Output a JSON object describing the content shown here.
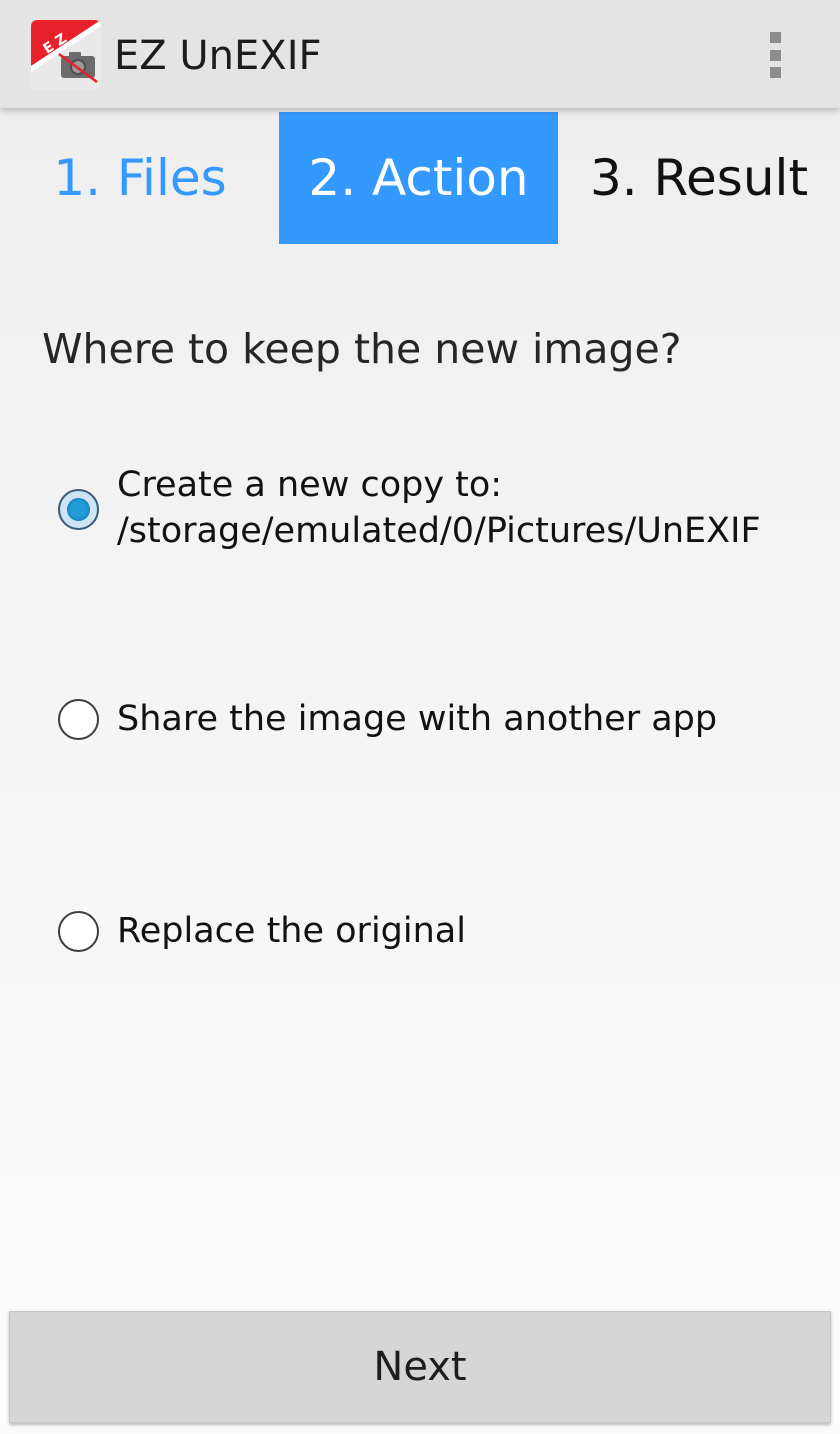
{
  "app": {
    "title": "EZ UnEXIF",
    "icon_name": "ez-unexif-app-icon",
    "icon_text": "E Z"
  },
  "menu": {
    "icon_name": "overflow-menu-icon"
  },
  "steps": [
    {
      "label": "1. Files",
      "state": "completed"
    },
    {
      "label": "2. Action",
      "state": "active"
    },
    {
      "label": "3. Result",
      "state": "pending"
    }
  ],
  "question": "Where to keep the new image?",
  "options": [
    {
      "label": "Create a new copy to: /storage/emulated/0/Pictures/UnEXIF",
      "checked": true
    },
    {
      "label": "Share the image with another app",
      "checked": false
    },
    {
      "label": "Replace the original",
      "checked": false
    }
  ],
  "next_label": "Next",
  "colors": {
    "accent": "#3399ff",
    "action_bar": "#e4e4e4",
    "radio_checked": "#1f9bd6"
  }
}
